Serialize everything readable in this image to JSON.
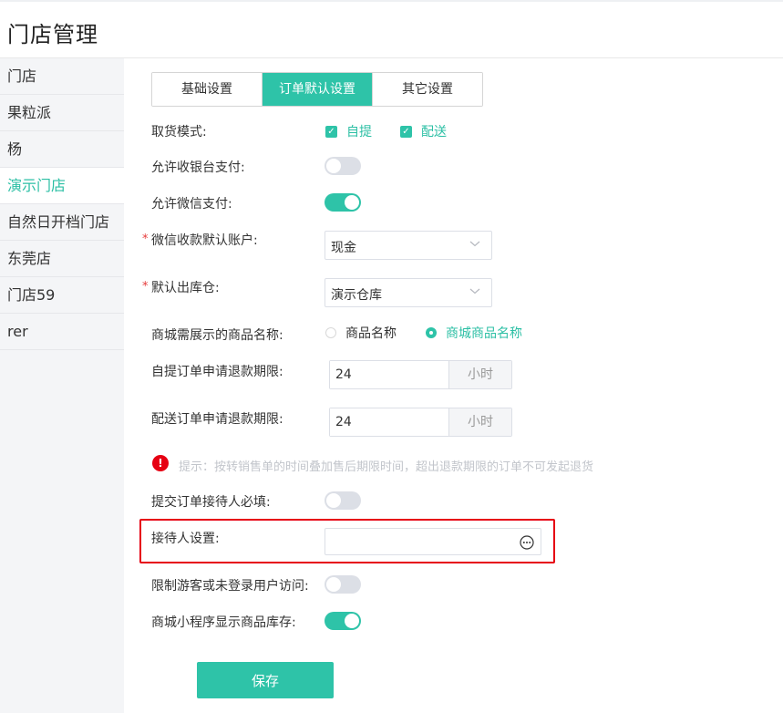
{
  "header": {
    "title": "门店管理"
  },
  "sidebar": {
    "items": [
      {
        "label": "门店"
      },
      {
        "label": "果粒派"
      },
      {
        "label": "杨"
      },
      {
        "label": "演示门店"
      },
      {
        "label": "自然日开档门店"
      },
      {
        "label": "东莞店"
      },
      {
        "label": "门店59"
      },
      {
        "label": "rer"
      }
    ],
    "active_index": 3
  },
  "tabs": [
    {
      "label": "基础设置"
    },
    {
      "label": "订单默认设置"
    },
    {
      "label": "其它设置"
    }
  ],
  "active_tab": 1,
  "form": {
    "pickup_mode": {
      "label": "取货模式:",
      "options": [
        {
          "label": "自提",
          "checked": true
        },
        {
          "label": "配送",
          "checked": true
        }
      ]
    },
    "cashier_pay": {
      "label": "允许收银台支付:",
      "enabled": false
    },
    "wechat_pay": {
      "label": "允许微信支付:",
      "enabled": true
    },
    "wechat_account": {
      "label": "微信收款默认账户:",
      "value": "现金",
      "required": true
    },
    "default_warehouse": {
      "label": "默认出库仓:",
      "value": "演示仓库",
      "required": true
    },
    "product_name_display": {
      "label": "商城需展示的商品名称:",
      "options": [
        "商品名称",
        "商城商品名称"
      ],
      "selected": "商城商品名称"
    },
    "pickup_refund_limit": {
      "label": "自提订单申请退款期限:",
      "value": "24",
      "unit": "小时"
    },
    "delivery_refund_limit": {
      "label": "配送订单申请退款期限:",
      "value": "24",
      "unit": "小时"
    },
    "tip": "提示：按转销售单的时间叠加售后期限时间，超出退款期限的订单不可发起退货",
    "receiver_required": {
      "label": "提交订单接待人必填:",
      "enabled": false
    },
    "receiver_setting": {
      "label": "接待人设置:",
      "value": ""
    },
    "restrict_guest": {
      "label": "限制游客或未登录用户访问:",
      "enabled": false
    },
    "show_stock": {
      "label": "商城小程序显示商品库存:",
      "enabled": true
    }
  },
  "actions": {
    "save_label": "保存"
  },
  "colors": {
    "accent": "#2ec3a8",
    "highlight_border": "#e60012",
    "required": "#e63b3b"
  }
}
